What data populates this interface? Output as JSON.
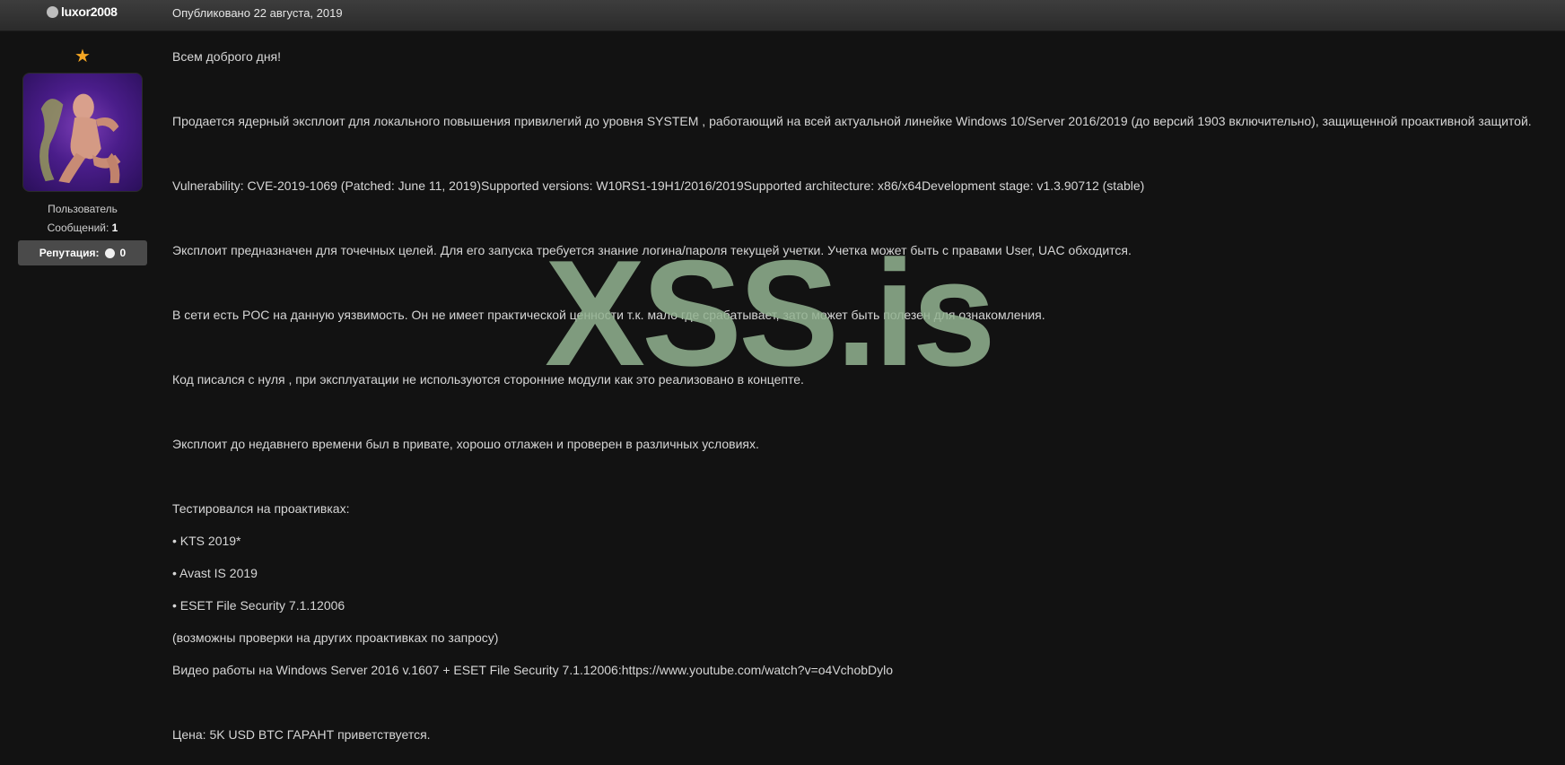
{
  "header": {
    "username": "luxor2008",
    "published": "Опубликовано 22 августа, 2019"
  },
  "user": {
    "rank_icon": "star-icon",
    "title": "Пользователь",
    "messages_label": "Сообщений:",
    "messages_count": "1",
    "reputation_label": "Репутация:",
    "reputation_value": "0"
  },
  "post": {
    "lines": [
      "Всем доброго дня!",
      "Продается ядерный эксплоит для локального повышения привилегий до уровня SYSTEM , работающий на всей актуальной линейке Windows 10/Server 2016/2019 (до версий 1903 включительно), защищенной проактивной защитой.",
      "Vulnerability: CVE-2019-1069 (Patched: June 11, 2019)Supported versions: W10RS1-19H1/2016/2019Supported architecture: x86/x64Development stage: v1.3.90712 (stable)",
      "Эксплоит предназначен для точечных целей. Для его запуска требуется знание логина/пароля текущей учетки. Учетка может быть с правами User, UAC обходится.",
      "В сети есть POC на данную уязвимость. Он не имеет практической ценности т.к. мало где срабатывает, зато может быть полезен для ознакомления.",
      "Код писался с нуля , при эксплуатации не используются сторонние модули как это реализовано в концепте.",
      "Эксплоит до недавнего времени был в привате, хорошо отлажен и проверен в различных условиях.",
      "Тестировался на проактивках:",
      "• KTS 2019*",
      "• Avast IS 2019",
      "• ESET File Security 7.1.12006",
      "(возможны проверки на других проактивках по запросу)",
      "Видео работы на Windows Server 2016 v.1607 + ESET File Security 7.1.12006:https://www.youtube.com/watch?v=o4VchobDylo",
      "Цена: 5K USD BTC ГАРАНТ приветствуется."
    ]
  },
  "watermark": "XSS.is"
}
